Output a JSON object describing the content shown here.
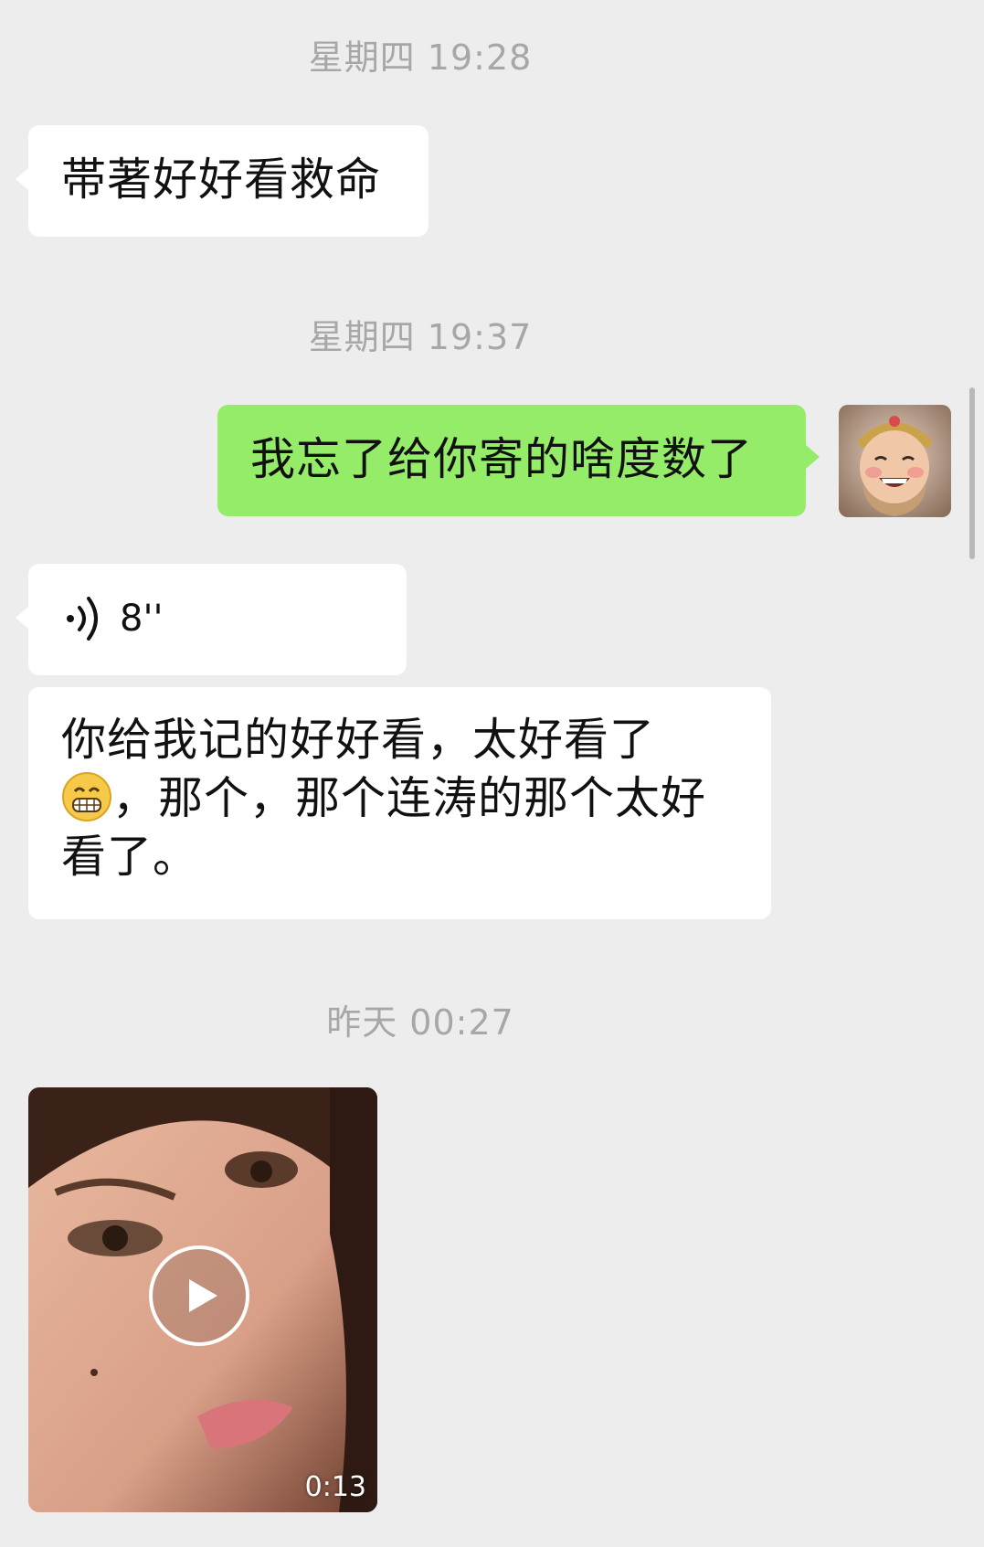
{
  "messages": [
    {
      "type": "timestamp",
      "text": "星期四 19:28"
    },
    {
      "type": "text",
      "direction": "incoming",
      "text": "帯著好好看救命"
    },
    {
      "type": "timestamp",
      "text": "星期四 19:37"
    },
    {
      "type": "text",
      "direction": "outgoing",
      "text": "我忘了给你寄的啥度数了"
    },
    {
      "type": "voice",
      "direction": "incoming",
      "duration": "8''"
    },
    {
      "type": "text",
      "direction": "incoming",
      "text_part1": "你给我记的好好看，太好看了",
      "emoji": "grinning-face-emoji",
      "text_part2": "，那个，那个连涛的那个太好看了。"
    },
    {
      "type": "timestamp",
      "text": "昨天 00:27"
    },
    {
      "type": "video",
      "direction": "incoming",
      "duration": "0:13"
    }
  ],
  "colors": {
    "background": "#ededed",
    "incoming_bubble": "#ffffff",
    "outgoing_bubble": "#95ec69",
    "timestamp_text": "#a7a7a7"
  },
  "icons": {
    "voice": "voice-wave-icon",
    "play": "play-icon",
    "avatar": "user-avatar"
  }
}
